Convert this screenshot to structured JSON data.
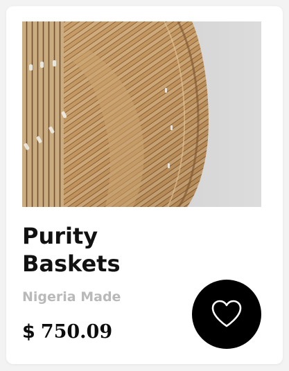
{
  "product": {
    "name": "Purity Baskets",
    "origin": "Nigeria Made",
    "currency": "$",
    "price": "750.09",
    "image": "woven-basket-photo"
  },
  "actions": {
    "favorite_icon": "heart-icon"
  },
  "colors": {
    "card_background": "#ffffff",
    "page_background": "#f3f3f3",
    "title": "#111111",
    "subtitle": "#b9b9b9",
    "favorite_button": "#000000",
    "favorite_icon": "#ffffff"
  }
}
